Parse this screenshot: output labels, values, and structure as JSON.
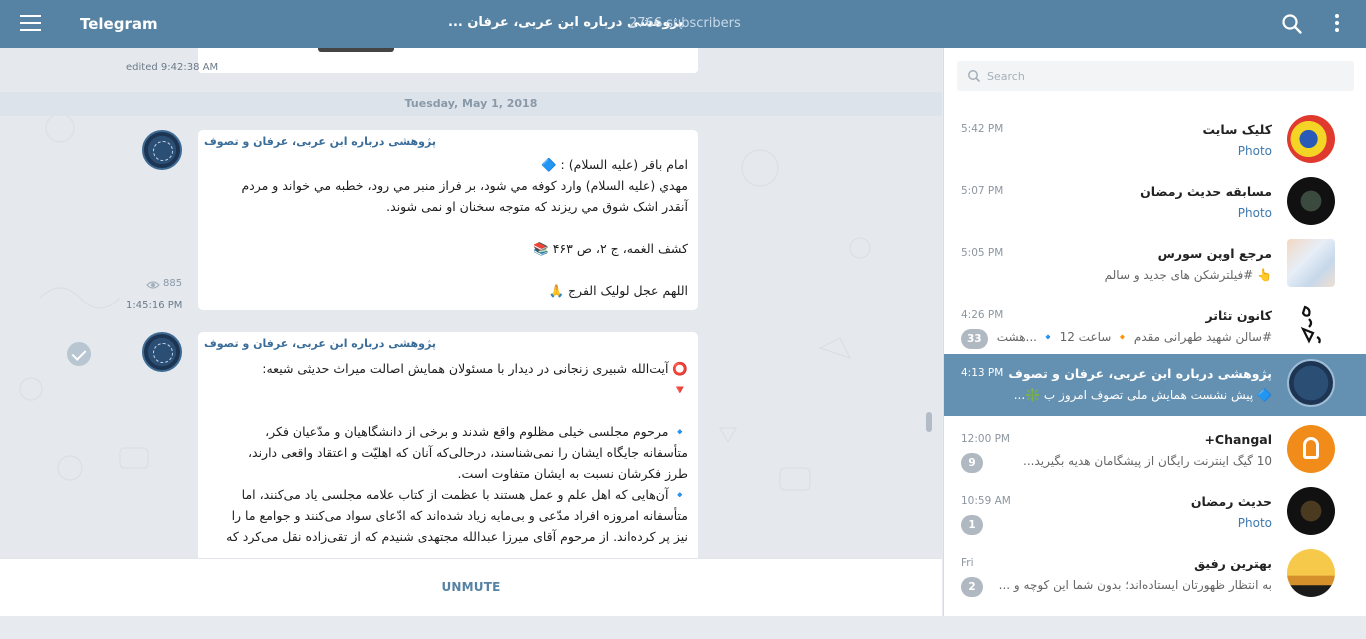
{
  "header": {
    "app_title": "Telegram",
    "channel_title": "پژوهشی درباره ابن عربی، عرفان ...",
    "subscribers": "2766 subscribers",
    "menu_icon": "hamburger-menu-icon",
    "search_icon": "search-icon",
    "more_icon": "vertical-dots-icon",
    "color": "#5682a3"
  },
  "chat": {
    "prev_message_time": "edited 9:42:38 AM",
    "date_separator": "Tuesday, May 1, 2018",
    "messages": [
      {
        "author": "پژوهشی درباره ابن عربی، عرفان و تصوف",
        "lines": [
          "امام باقر (عليه السلام) : 🔷",
          "مهدي (عليه السلام) وارد كوفه مي شود، بر فراز منبر مي رود، خطبه مي خواند و مردم",
          "آنقدر اشک شوق مي ريزند كه متوجه سخنان او نمی شوند.",
          "",
          "كشف الغمه، ج ۲، ص ۴۶۳ 📚",
          "",
          "اللهم عجل لولیک الفرج 🙏"
        ],
        "views": "885",
        "time": "1:45:16 PM"
      },
      {
        "author": "پژوهشی درباره ابن عربی، عرفان و تصوف",
        "lines": [
          "⭕ آیت‌الله شبیری زنجانی در دیدار با مسئولان همایش اصالت میراث حدیثی شیعه:",
          "🔻",
          "",
          "🔹 مرحوم مجلسی خیلی مظلوم واقع شدند و برخی از دانشگاهیان و مدّعیان فکر،",
          "متأسفانه جایگاه ایشان را نمی‌شناسند، درحالی‌که آنان که اهلیّت و اعتقاد واقعی دارند،",
          "طرز فکرشان نسبت به ایشان متفاوت است.",
          "🔹 آن‌هایی که اهل علم و عمل هستند با عظمت از کتاب علامه مجلسی یاد می‌کنند، اما",
          "متأسفانه امروزه افراد مدّعی و بی‌مایه زیاد شده‌اند که ادّعای سواد می‌کنند و جوامع ما را",
          "نیز پر کرده‌اند. از مرحوم آقای میرزا عبدالله مجتهدی شنیدم که از تقی‌زاده نقل می‌کرد که"
        ]
      }
    ],
    "unmute_label": "UNMUTE"
  },
  "sidebar": {
    "search_placeholder": "Search",
    "dialogs": [
      {
        "time": "5:42 PM",
        "name": "کلیک سایت",
        "message": "Photo",
        "photo": true,
        "badge": ""
      },
      {
        "time": "5:07 PM",
        "name": "مسابقه حدیث رمضان",
        "message": "Photo",
        "photo": true,
        "badge": ""
      },
      {
        "time": "5:05 PM",
        "name": "مرجع اوپن سورس",
        "message": "👆 #فیلترشکن های جدید و سالم",
        "photo": false,
        "badge": ""
      },
      {
        "time": "4:26 PM",
        "name": "کانون تئاتر",
        "message": "#سالن شهید طهرانی مقدم 🔸 ساعت 12 🔹 ...هشت",
        "photo": false,
        "badge": "33"
      },
      {
        "time": "4:13 PM",
        "name": "پژوهشی درباره ابن عربی، عرفان و تصوف",
        "message": "🔷 پیش نشست همایش ملی تصوف امروز ب ❇️...",
        "photo": false,
        "badge": "",
        "active": true
      },
      {
        "time": "12:00 PM",
        "name": "Changal+",
        "message": "10 گیگ اینترنت رایگان از پیشگامان هدیه بگیرید...",
        "photo": false,
        "badge": "9"
      },
      {
        "time": "10:59 AM",
        "name": "حدیث رمضان",
        "message": "Photo",
        "photo": true,
        "badge": "1"
      },
      {
        "time": "Fri",
        "name": "بهترین رفیق",
        "message": "به انتظار ظهورتان ایستاده‌اند؛ بدون شما این کوچه و ...",
        "photo": false,
        "badge": "2"
      }
    ]
  }
}
